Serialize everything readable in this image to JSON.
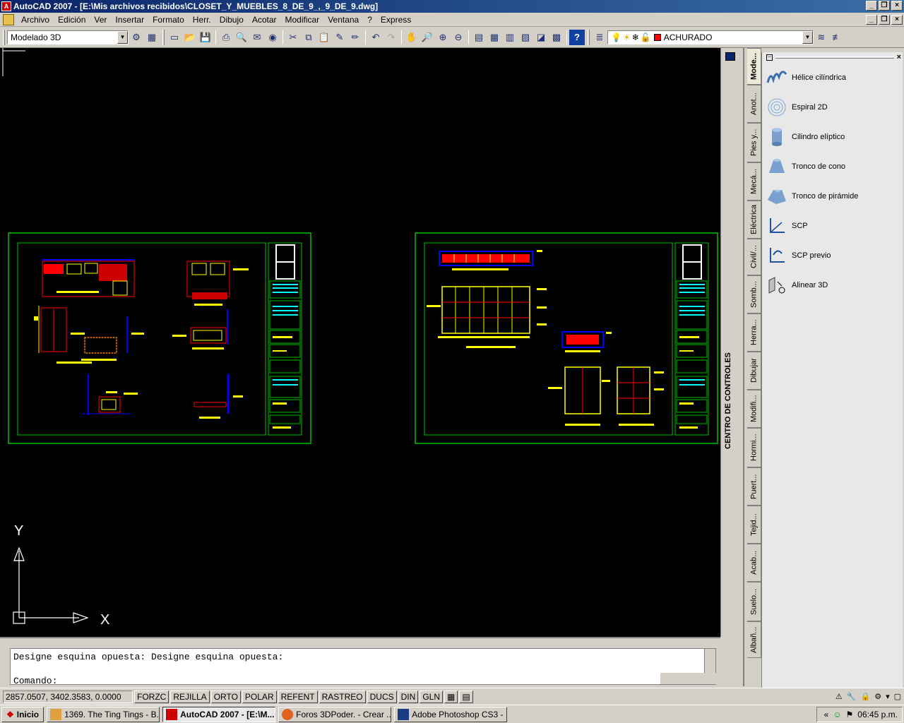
{
  "window": {
    "title": "AutoCAD 2007 - [E:\\Mis archivos recibidos\\CLOSET_Y_MUEBLES_8_DE_9_,_9_DE_9.dwg]",
    "app_icon_text": "A"
  },
  "menu": {
    "items": [
      "Archivo",
      "Edición",
      "Ver",
      "Insertar",
      "Formato",
      "Herr.",
      "Dibujo",
      "Acotar",
      "Modificar",
      "Ventana",
      "?",
      "Express"
    ]
  },
  "toolbar": {
    "workspace": "Modelado 3D",
    "layer": "ACHURADO",
    "layer_color": "#ff0000"
  },
  "canvas": {
    "background": "#000000",
    "ucs_y": "Y",
    "ucs_x": "X"
  },
  "control_strip": {
    "label": "CENTRO DE CONTROLES"
  },
  "palette": {
    "tabs": [
      "Mode...",
      "Anot...",
      "Pies y...",
      "Mecá...",
      "Eléctrica",
      "Civil/...",
      "Somb...",
      "Herra...",
      "Dibujar",
      "Modifi...",
      "Hormi...",
      "Puert...",
      "Tejid...",
      "Acab...",
      "Suelo...",
      "Albañ..."
    ],
    "tools": [
      {
        "label": "Hélice cilíndrica",
        "icon": "helix-icon"
      },
      {
        "label": "Espiral 2D",
        "icon": "spiral-icon"
      },
      {
        "label": "Cilindro elíptico",
        "icon": "elliptic-cylinder-icon"
      },
      {
        "label": "Tronco de cono",
        "icon": "cone-frustum-icon"
      },
      {
        "label": "Tronco de pirámide",
        "icon": "pyramid-frustum-icon"
      },
      {
        "label": "SCP",
        "icon": "ucs-icon"
      },
      {
        "label": "SCP previo",
        "icon": "ucs-previous-icon"
      },
      {
        "label": "Alinear 3D",
        "icon": "align-3d-icon"
      }
    ]
  },
  "command": {
    "history": "Designe esquina opuesta: Designe esquina opuesta:",
    "prompt": "Comando:"
  },
  "status": {
    "coords": "2857.0507, 3402.3583, 0.0000",
    "buttons": [
      "FORZC",
      "REJILLA",
      "ORTO",
      "POLAR",
      "REFENT",
      "RASTREO",
      "DUCS",
      "DIN",
      "GLN"
    ]
  },
  "taskbar": {
    "start": "Inicio",
    "items": [
      {
        "label": "1369. The Ting Tings - B...",
        "active": false
      },
      {
        "label": "AutoCAD 2007 - [E:\\M...",
        "active": true
      },
      {
        "label": "Foros 3DPoder. - Crear ...",
        "active": false
      },
      {
        "label": "Adobe Photoshop CS3 - ...",
        "active": false
      }
    ],
    "clock": "06:45 p.m."
  }
}
